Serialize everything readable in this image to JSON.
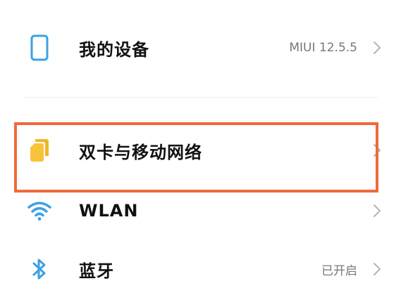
{
  "settings": {
    "items": [
      {
        "label": "我的设备",
        "value": "MIUI 12.5.5",
        "icon": "phone-icon",
        "icon_color": "#3aa0e6"
      },
      {
        "label": "双卡与移动网络",
        "value": "",
        "icon": "sim-card-icon",
        "icon_color": "#f7c33b"
      },
      {
        "label": "WLAN",
        "value": "",
        "icon": "wifi-icon",
        "icon_color": "#3aa0e6"
      },
      {
        "label": "蓝牙",
        "value": "已开启",
        "icon": "bluetooth-icon",
        "icon_color": "#3aa0e6"
      }
    ],
    "highlight_color": "#ee6a3d",
    "chevron_icon": "chevron-right-icon"
  }
}
